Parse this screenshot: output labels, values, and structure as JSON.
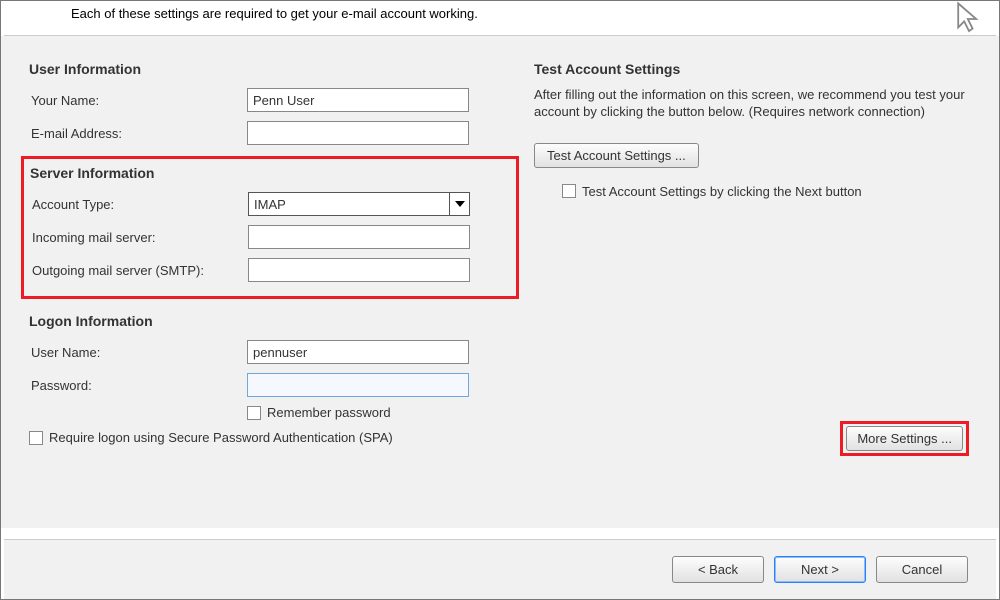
{
  "header": {
    "instruction": "Each of these settings are required to get your e-mail account working."
  },
  "userInfo": {
    "title": "User Information",
    "nameLabel": "Your Name:",
    "nameValue": "Penn User",
    "emailLabel": "E-mail Address:",
    "emailValue": ""
  },
  "serverInfo": {
    "title": "Server Information",
    "typeLabel": "Account Type:",
    "typeValue": "IMAP",
    "incomingLabel": "Incoming mail server:",
    "incomingValue": "",
    "outgoingLabel": "Outgoing mail server (SMTP):",
    "outgoingValue": ""
  },
  "logonInfo": {
    "title": "Logon Information",
    "userLabel": "User Name:",
    "userValue": "pennuser",
    "passLabel": "Password:",
    "passValue": "",
    "rememberLabel": "Remember password",
    "spaLabel": "Require logon using Secure Password Authentication (SPA)"
  },
  "test": {
    "title": "Test Account Settings",
    "desc": "After filling out the information on this screen, we recommend you test your account by clicking the button below. (Requires network connection)",
    "buttonLabel": "Test Account Settings ...",
    "autoTestLabel": "Test Account Settings by clicking the Next button"
  },
  "more": {
    "label": "More Settings ..."
  },
  "footer": {
    "back": "< Back",
    "next": "Next >",
    "cancel": "Cancel"
  }
}
